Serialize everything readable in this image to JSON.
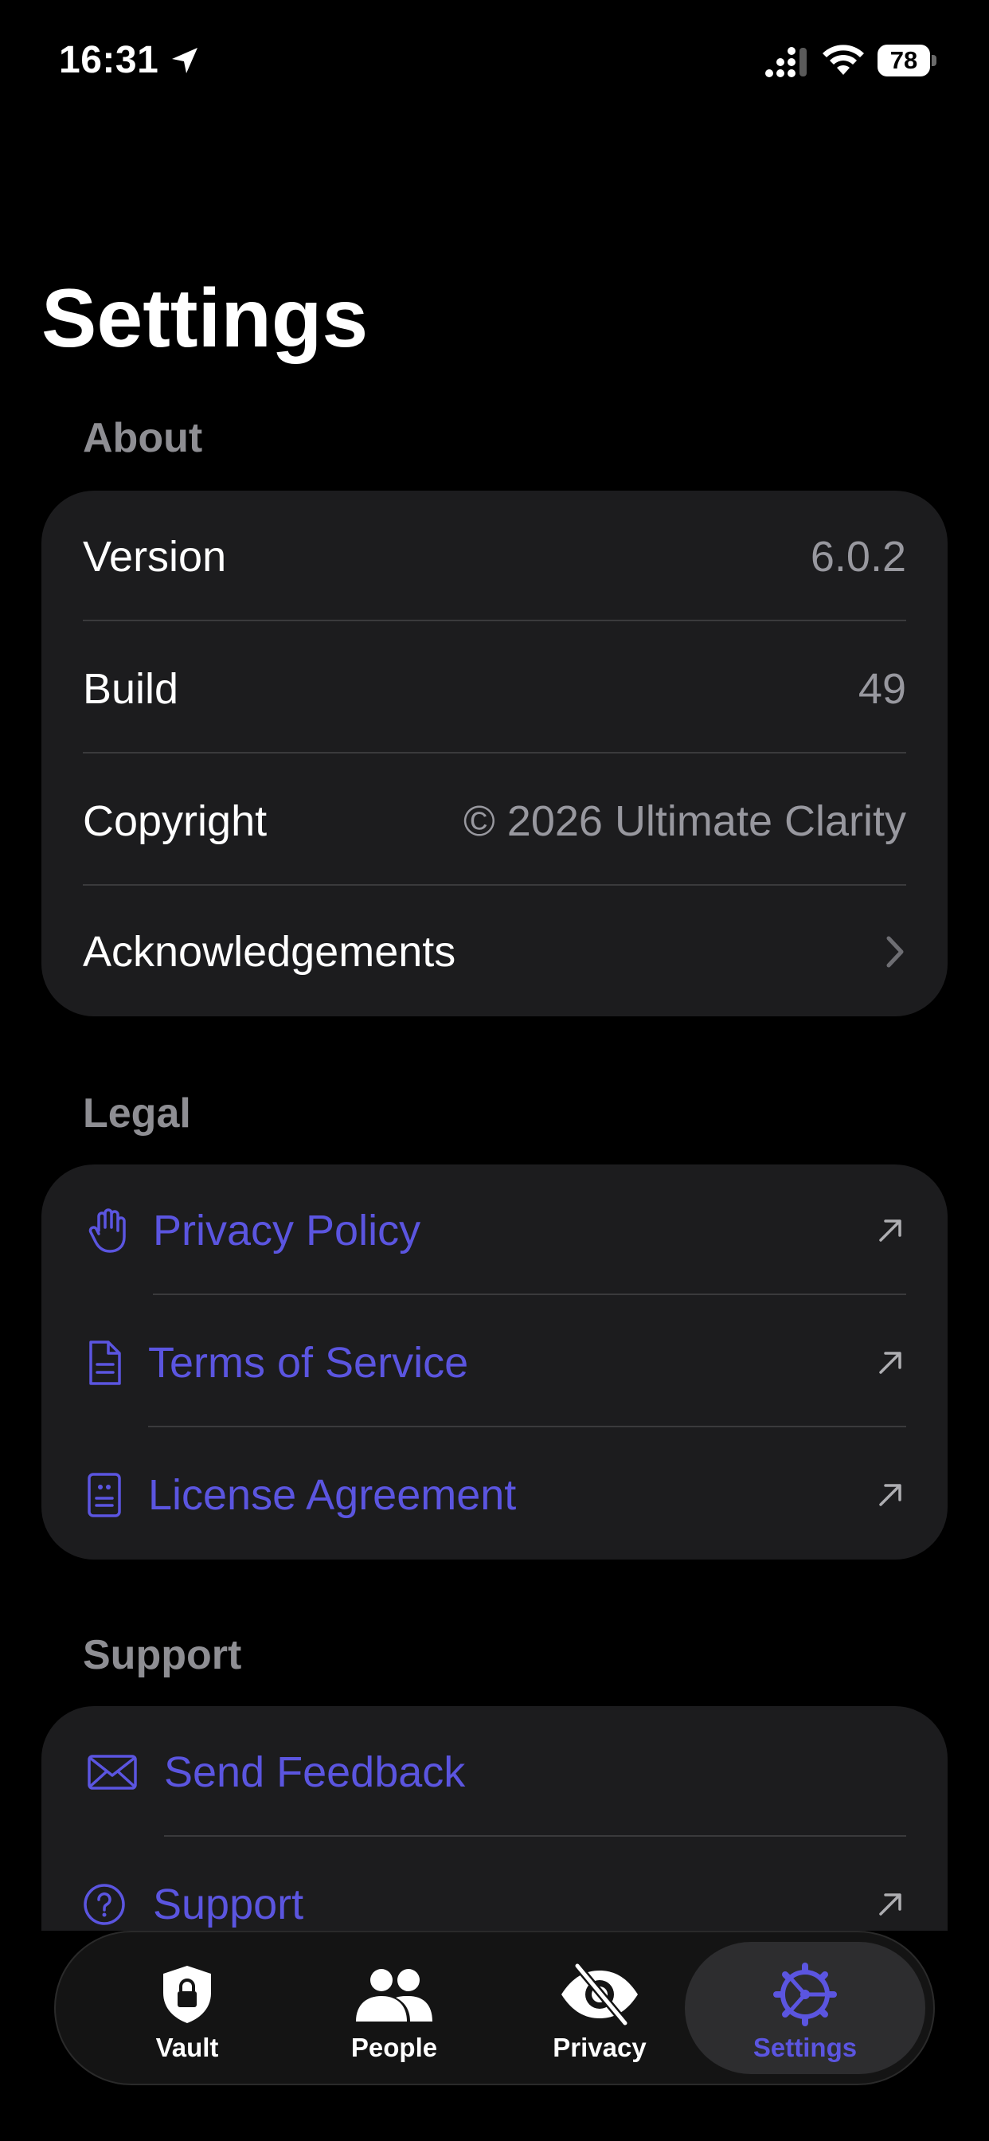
{
  "status_bar": {
    "time": "16:31",
    "battery": "78"
  },
  "page": {
    "title": "Settings"
  },
  "about": {
    "header": "About",
    "rows": [
      {
        "label": "Version",
        "value": "6.0.2"
      },
      {
        "label": "Build",
        "value": "49"
      },
      {
        "label": "Copyright",
        "value": "© 2026 Ultimate Clarity"
      },
      {
        "label": "Acknowledgements"
      }
    ]
  },
  "legal": {
    "header": "Legal",
    "items": [
      {
        "label": "Privacy Policy",
        "icon": "hand-icon"
      },
      {
        "label": "Terms of Service",
        "icon": "document-icon"
      },
      {
        "label": "License Agreement",
        "icon": "license-icon"
      }
    ]
  },
  "support": {
    "header": "Support",
    "items": [
      {
        "label": "Send Feedback",
        "icon": "envelope-icon"
      },
      {
        "label": "Support",
        "icon": "question-circle-icon"
      }
    ]
  },
  "tab_bar": {
    "tabs": [
      {
        "label": "Vault",
        "icon": "shield-lock-icon"
      },
      {
        "label": "People",
        "icon": "people-icon"
      },
      {
        "label": "Privacy",
        "icon": "eye-slash-icon"
      },
      {
        "label": "Settings",
        "icon": "gear-icon",
        "selected": true
      }
    ]
  },
  "colors": {
    "accent": "#5b55e0",
    "card": "#1c1c1e",
    "secondary_text": "#98989f",
    "header_text": "#8e8e93"
  }
}
